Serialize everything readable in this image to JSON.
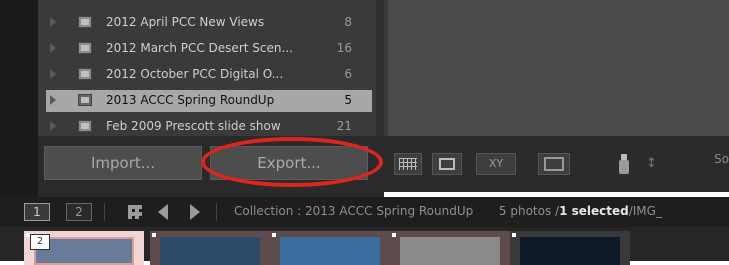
{
  "collections": {
    "items": [
      {
        "label": "2012 April PCC New Views",
        "count": "8",
        "selected": false
      },
      {
        "label": "2012 March PCC Desert Scen...",
        "count": "16",
        "selected": false
      },
      {
        "label": "2012 October PCC Digital O...",
        "count": "6",
        "selected": false
      },
      {
        "label": "2013 ACCC Spring RoundUp",
        "count": "5",
        "selected": true
      },
      {
        "label": "Feb 2009 Prescott slide show",
        "count": "21",
        "selected": false
      }
    ]
  },
  "buttons": {
    "import_label": "Import...",
    "export_label": "Export..."
  },
  "toolbar": {
    "xy_label": "XY",
    "sort_glyph": "↕",
    "sort_label": "So"
  },
  "filmstrip": {
    "page1": "1",
    "page2": "2",
    "source_label": "Collection : 2013 ACCC Spring RoundUp",
    "count_label": "5 photos /",
    "selected_label": "1 selected",
    "file_label": "/IMG_"
  },
  "thumbs": {
    "first_number": "2"
  },
  "annotation": {
    "color": "#e0241e"
  }
}
